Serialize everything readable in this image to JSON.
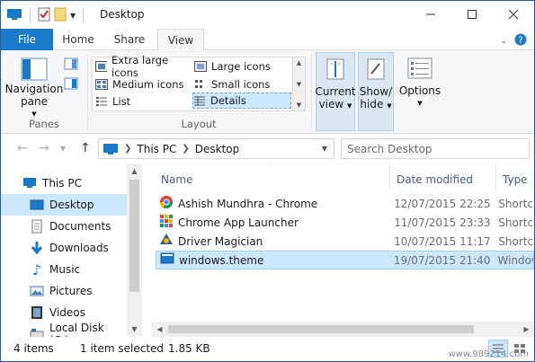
{
  "window": {
    "title": "Desktop"
  },
  "colors": {
    "accent": "#1979ca",
    "selection": "#cce8ff",
    "folder": "#f8d775"
  },
  "ribbon": {
    "tabs": [
      {
        "label": "File",
        "active": false
      },
      {
        "label": "Home",
        "active": false
      },
      {
        "label": "Share",
        "active": false
      },
      {
        "label": "View",
        "active": true
      }
    ],
    "panes_group": {
      "navigation_pane_line1": "Navigation",
      "navigation_pane_line2": "pane",
      "label": "Panes"
    },
    "layout_group": {
      "label": "Layout",
      "items": [
        {
          "label": "Extra large icons",
          "icon": "extra-large-icons-icon"
        },
        {
          "label": "Large icons",
          "icon": "large-icons-icon"
        },
        {
          "label": "Medium icons",
          "icon": "medium-icons-icon"
        },
        {
          "label": "Small icons",
          "icon": "small-icons-icon"
        },
        {
          "label": "List",
          "icon": "list-icon"
        },
        {
          "label": "Details",
          "icon": "details-icon",
          "selected": true
        }
      ]
    },
    "current_view": {
      "line1": "Current",
      "line2": "view"
    },
    "show_hide": {
      "line1": "Show/",
      "line2": "hide"
    },
    "options": {
      "label": "Options"
    }
  },
  "address": {
    "root_icon": "this-pc-icon",
    "crumbs": [
      "This PC",
      "Desktop"
    ],
    "search_placeholder": "Search Desktop"
  },
  "nav_pane": {
    "items": [
      {
        "label": "This PC",
        "icon": "computer-icon",
        "selected": false
      },
      {
        "label": "Desktop",
        "icon": "desktop-icon",
        "selected": true
      },
      {
        "label": "Documents",
        "icon": "documents-icon",
        "selected": false
      },
      {
        "label": "Downloads",
        "icon": "downloads-icon",
        "selected": false
      },
      {
        "label": "Music",
        "icon": "music-icon",
        "selected": false
      },
      {
        "label": "Pictures",
        "icon": "pictures-icon",
        "selected": false
      },
      {
        "label": "Videos",
        "icon": "videos-icon",
        "selected": false
      },
      {
        "label": "Local Disk (C:)",
        "icon": "disk-icon",
        "selected": false
      }
    ]
  },
  "file_list": {
    "columns": [
      "Name",
      "Date modified",
      "Type"
    ],
    "rows": [
      {
        "name": "Ashish Mundhra - Chrome",
        "date": "12/07/2015 22:25",
        "type": "Shortcut",
        "icon": "chrome-shortcut-icon",
        "selected": false
      },
      {
        "name": "Chrome App Launcher",
        "date": "11/07/2015 23:33",
        "type": "Shortcut",
        "icon": "app-launcher-icon",
        "selected": false
      },
      {
        "name": "Driver Magician",
        "date": "10/07/2015 11:17",
        "type": "Shortcut",
        "icon": "driver-magician-icon",
        "selected": false
      },
      {
        "name": "windows.theme",
        "date": "19/07/2015 21:40",
        "type": "Windows",
        "icon": "theme-file-icon",
        "selected": true
      }
    ]
  },
  "status": {
    "item_count": "4 items",
    "selection": "1 item selected",
    "size": "1.85 KB"
  },
  "watermark": "www.989214.com"
}
